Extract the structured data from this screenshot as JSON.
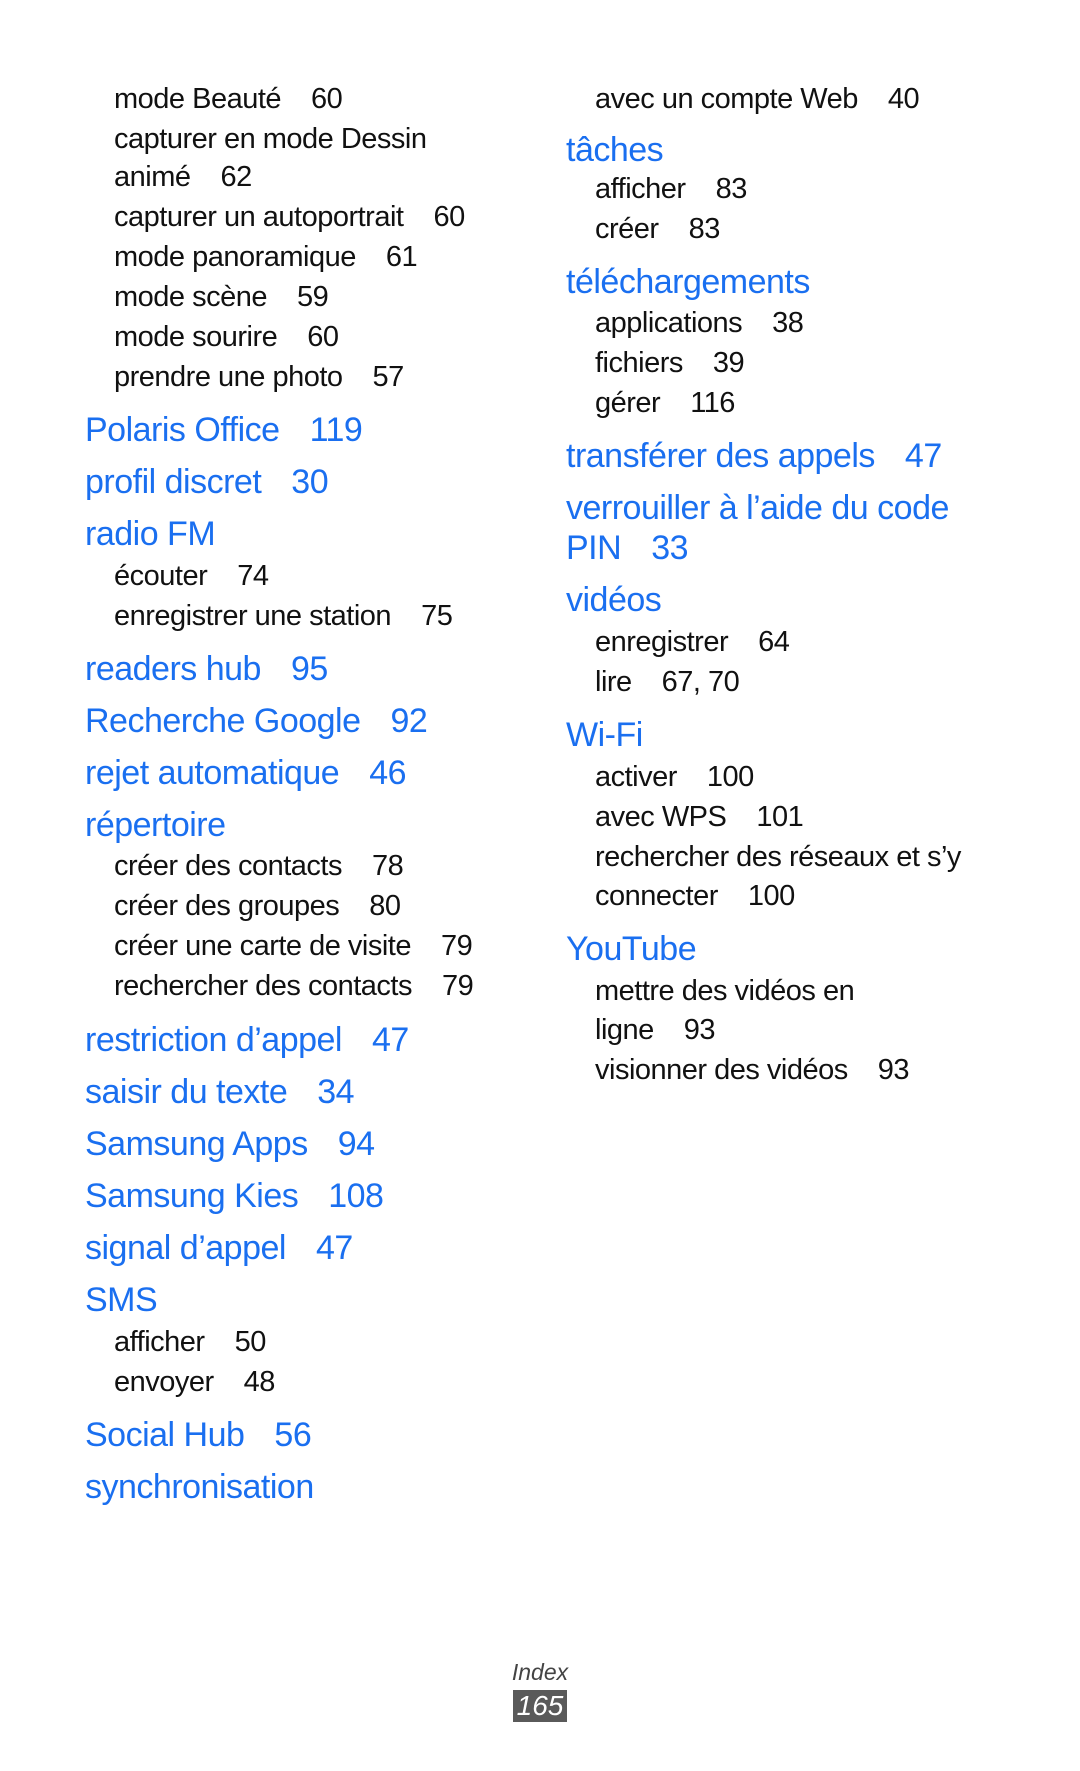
{
  "document": {
    "section": "Index",
    "page_number": "165",
    "accent_color": "#1a6ff0"
  },
  "columns": [
    {
      "lines": [
        {
          "kind": "sub",
          "text": "mode Beauté",
          "page": "60"
        },
        {
          "kind": "sub",
          "text": "capturer en mode Dessin",
          "page": ""
        },
        {
          "kind": "sub",
          "text": "animé",
          "page": "62"
        },
        {
          "kind": "sub",
          "text": "capturer un autoportrait",
          "page": "60"
        },
        {
          "kind": "sub",
          "text": "mode panoramique",
          "page": "61"
        },
        {
          "kind": "sub",
          "text": "mode scène",
          "page": "59"
        },
        {
          "kind": "sub",
          "text": "mode sourire",
          "page": "60"
        },
        {
          "kind": "sub",
          "text": "prendre une photo",
          "page": "57"
        },
        {
          "kind": "head",
          "text": "Polaris Office",
          "page": "119"
        },
        {
          "kind": "head",
          "text": "profil discret",
          "page": "30"
        },
        {
          "kind": "head",
          "text": "radio FM",
          "page": ""
        },
        {
          "kind": "sub",
          "text": "écouter",
          "page": "74"
        },
        {
          "kind": "sub",
          "text": "enregistrer une station",
          "page": "75"
        },
        {
          "kind": "head",
          "text": "readers hub",
          "page": "95"
        },
        {
          "kind": "head",
          "text": "Recherche Google",
          "page": "92"
        },
        {
          "kind": "head",
          "text": "rejet automatique",
          "page": "46"
        },
        {
          "kind": "head",
          "text": "répertoire",
          "page": ""
        },
        {
          "kind": "sub",
          "text": "créer des contacts",
          "page": "78"
        },
        {
          "kind": "sub",
          "text": "créer des groupes",
          "page": "80"
        },
        {
          "kind": "sub",
          "text": "créer une carte de visite",
          "page": "79"
        },
        {
          "kind": "sub",
          "text": "rechercher des contacts",
          "page": "79"
        },
        {
          "kind": "head",
          "text": "restriction d’appel",
          "page": "47"
        },
        {
          "kind": "head",
          "text": "saisir du texte",
          "page": "34"
        },
        {
          "kind": "head",
          "text": "Samsung Apps",
          "page": "94"
        },
        {
          "kind": "head",
          "text": "Samsung Kies",
          "page": "108"
        },
        {
          "kind": "head",
          "text": "signal d’appel",
          "page": "47"
        },
        {
          "kind": "head",
          "text": "SMS",
          "page": ""
        },
        {
          "kind": "sub",
          "text": "afficher",
          "page": "50"
        },
        {
          "kind": "sub",
          "text": "envoyer",
          "page": "48"
        },
        {
          "kind": "head",
          "text": "Social Hub",
          "page": "56"
        },
        {
          "kind": "head",
          "text": "synchronisation",
          "page": ""
        }
      ]
    },
    {
      "lines": [
        {
          "kind": "sub",
          "text": "avec un compte Web",
          "page": "40"
        },
        {
          "kind": "head",
          "text": "tâches",
          "page": ""
        },
        {
          "kind": "sub",
          "text": "afficher",
          "page": "83"
        },
        {
          "kind": "sub",
          "text": "créer",
          "page": "83"
        },
        {
          "kind": "head",
          "text": "téléchargements",
          "page": ""
        },
        {
          "kind": "sub",
          "text": "applications",
          "page": "38"
        },
        {
          "kind": "sub",
          "text": "fichiers",
          "page": "39"
        },
        {
          "kind": "sub",
          "text": "gérer",
          "page": "116"
        },
        {
          "kind": "head",
          "text": "transférer des appels",
          "page": "47"
        },
        {
          "kind": "head",
          "text": "verrouiller à l’aide du code",
          "page": ""
        },
        {
          "kind": "head",
          "text": "PIN",
          "page": "33"
        },
        {
          "kind": "head",
          "text": "vidéos",
          "page": ""
        },
        {
          "kind": "sub",
          "text": "enregistrer",
          "page": "64"
        },
        {
          "kind": "sub",
          "text": "lire",
          "page": "67, 70"
        },
        {
          "kind": "head",
          "text": "Wi-Fi",
          "page": ""
        },
        {
          "kind": "sub",
          "text": "activer",
          "page": "100"
        },
        {
          "kind": "sub",
          "text": "avec WPS",
          "page": "101"
        },
        {
          "kind": "sub",
          "text": "rechercher des réseaux et s’y",
          "page": ""
        },
        {
          "kind": "sub",
          "text": "connecter",
          "page": "100"
        },
        {
          "kind": "head",
          "text": "YouTube",
          "page": ""
        },
        {
          "kind": "sub",
          "text": "mettre des vidéos en",
          "page": ""
        },
        {
          "kind": "sub",
          "text": "ligne",
          "page": "93"
        },
        {
          "kind": "sub",
          "text": "visionner des vidéos",
          "page": "93"
        }
      ]
    }
  ]
}
